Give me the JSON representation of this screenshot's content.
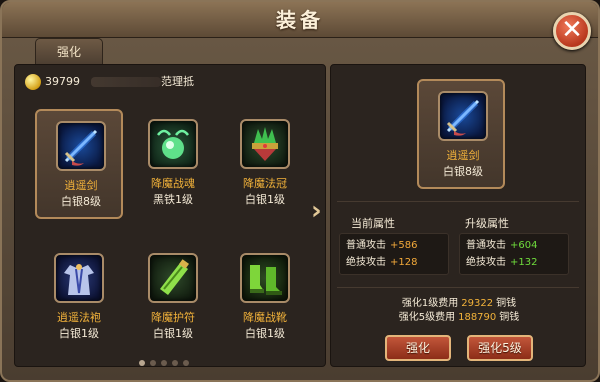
{
  "window": {
    "title": "装备",
    "close_label": "✕"
  },
  "tabs": [
    {
      "label": "强化"
    }
  ],
  "currency": {
    "amount": "39799",
    "player_name": "范理抵"
  },
  "items": [
    {
      "name": "逍遥剑",
      "level": "白银8级",
      "name_color": "#f2b23a",
      "icon": "sword-icon",
      "selected": true
    },
    {
      "name": "降魔战魂",
      "level": "黑铁1级",
      "name_color": "#f2b23a",
      "icon": "green-orb-icon",
      "selected": false
    },
    {
      "name": "降魔法冠",
      "level": "白银1级",
      "name_color": "#f2b23a",
      "icon": "helmet-icon",
      "selected": false
    },
    {
      "name": "逍遥法袍",
      "level": "白银1级",
      "name_color": "#f2b23a",
      "icon": "robe-icon",
      "selected": false
    },
    {
      "name": "降魔护符",
      "level": "白银1级",
      "name_color": "#f2b23a",
      "icon": "talisman-icon",
      "selected": false
    },
    {
      "name": "降魔战靴",
      "level": "白银1级",
      "name_color": "#f2b23a",
      "icon": "boots-icon",
      "selected": false
    }
  ],
  "pagination": {
    "count": 5,
    "active": 0
  },
  "detail": {
    "name": "逍遥剑",
    "level": "白银8级",
    "current": {
      "header": "当前属性",
      "stats": [
        {
          "label": "普通攻击",
          "value": "+586"
        },
        {
          "label": "绝技攻击",
          "value": "+128"
        }
      ]
    },
    "upgrade": {
      "header": "升级属性",
      "stats": [
        {
          "label": "普通攻击",
          "value": "+604"
        },
        {
          "label": "绝技攻击",
          "value": "+132"
        }
      ]
    },
    "costs": [
      {
        "label": "强化1级费用",
        "amount": "29322",
        "unit": "铜钱"
      },
      {
        "label": "强化5级费用",
        "amount": "188790",
        "unit": "铜钱"
      }
    ],
    "buttons": {
      "enhance": "强化",
      "enhance5": "强化5级"
    }
  },
  "colors": {
    "orange": "#f2b23a",
    "green": "#6fdc3c",
    "value_orange": "#f2a93a"
  }
}
